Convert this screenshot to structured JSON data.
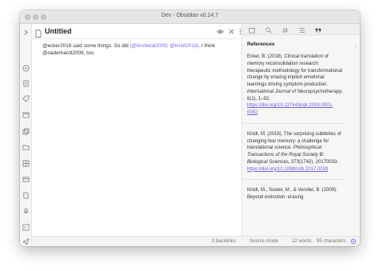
{
  "window": {
    "title": "Dev - Obsidian v0.14.7"
  },
  "ribbon": {
    "icons": [
      "collapse-icon",
      "graph-icon",
      "file-icon",
      "tag-icon",
      "calendar-icon",
      "copy-icon",
      "folder-icon",
      "layers-icon",
      "archive-icon",
      "page-icon",
      "microphone-icon",
      "terminal-icon",
      "send-icon"
    ]
  },
  "editor": {
    "title": "Untitled",
    "content": {
      "line_before": "@ecker2018 said some things. So did ",
      "citation": "[@kindtetal2009; @kindt2018]",
      "line_after": ". I think @naderhardt2009, too."
    }
  },
  "references_pane": {
    "heading": "References",
    "tabs": [
      "file-explorer-icon",
      "search-icon",
      "tag-icon",
      "outline-icon",
      "quote-icon"
    ],
    "refs": [
      {
        "prefix": "Ecker, B. (2018). Clinical translation of memory reconsolidation research: therapeutic methodology for transformational change by erasing implicit emotional learnings driving symptom production. ",
        "journal": "International Journal of Neuropsychotherapy",
        "suffix": ", 6(1), 1–92.",
        "link": "https://doi.org/10.12744/ijnpt.2018.0001-0092"
      },
      {
        "prefix": "Kindt, M. (2018). The surprising subtleties of changing fear memory: a challenge for translational science. ",
        "journal": "Philosophical Transactions of the Royal Society B: Biological Sciences",
        "suffix": ", 373(1742), 20170033.",
        "link": "https://doi.org/10.1098/rstb.2017.0033"
      },
      {
        "prefix": "Kindt, M., Soeter, M., & Vervliet, B. (2009). Beyond extinction: erasing",
        "journal": "",
        "suffix": "",
        "link": ""
      }
    ]
  },
  "statusbar": {
    "backlinks": "0 backlinks",
    "mode": "Source mode",
    "words": "12 words",
    "characters": "95 characters"
  },
  "colors": {
    "accent": "#7f6df2",
    "link": "#6e5fd8"
  }
}
